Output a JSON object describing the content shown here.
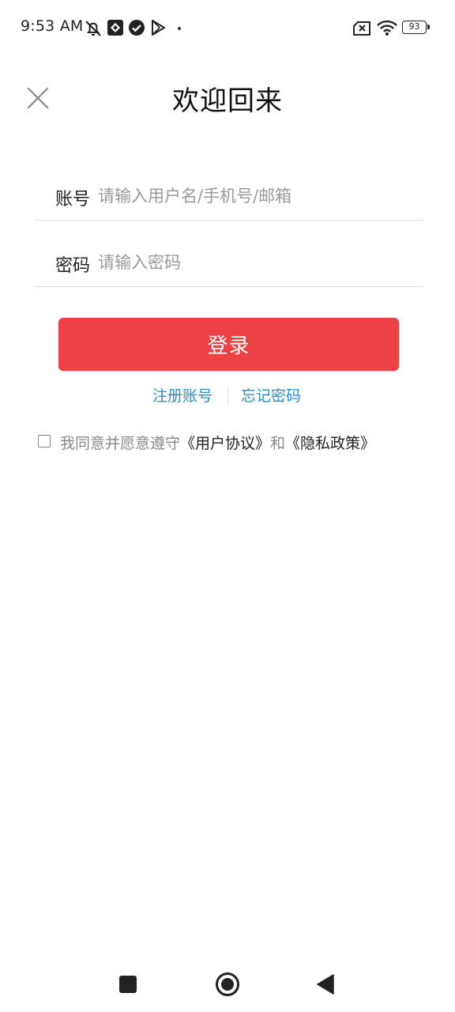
{
  "status_bar": {
    "time": "9:53 AM",
    "icons": [
      "bell-off-icon",
      "app-notification-icon",
      "check-circle-icon",
      "play-store-icon",
      "dot-icon",
      "no-sim-icon",
      "wifi-icon",
      "battery-icon"
    ],
    "battery": "93"
  },
  "header": {
    "title": "欢迎回来",
    "close_icon": "close-icon"
  },
  "form": {
    "account": {
      "label": "账号",
      "value": "",
      "placeholder": "请输入用户名/手机号/邮箱"
    },
    "password": {
      "label": "密码",
      "value": "",
      "placeholder": "请输入密码"
    },
    "login_label": "登录"
  },
  "links": {
    "register": "注册账号",
    "forgot_password": "忘记密码"
  },
  "agreement": {
    "checked": false,
    "prefix": "我同意并愿意遵守",
    "user_agreement": "《用户协议》",
    "and": "和",
    "privacy_policy": "《隐私政策》"
  },
  "nav_bar": {
    "icons": [
      "recents-square-icon",
      "home-circle-icon",
      "back-triangle-icon"
    ]
  },
  "colors": {
    "accent": "#ec4245",
    "link": "#2b8ec8",
    "background": "#ffffff"
  }
}
